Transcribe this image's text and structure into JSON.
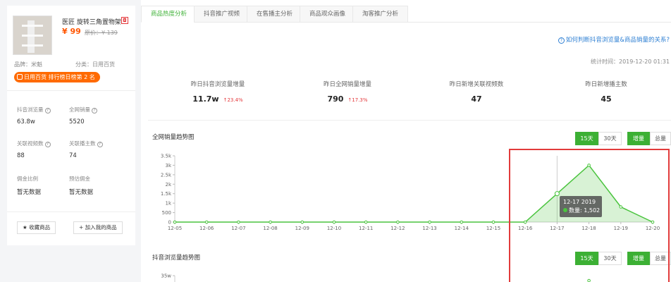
{
  "product": {
    "name": "医匠 旋转三角置物架",
    "price": "¥ 99",
    "original_price": "原价：¥ 139",
    "brand": "品牌：米魁",
    "category": "分类：日用百货",
    "rank_badge": "日用百货 排行榜日榜第 2 名"
  },
  "left_stats": [
    {
      "label": "抖音浏览量",
      "value": "63.8w"
    },
    {
      "label": "全网销量",
      "value": "5520"
    },
    {
      "label": "关联视频数",
      "value": "88"
    },
    {
      "label": "关联播主数",
      "value": "74"
    },
    {
      "label": "佣金比例",
      "value": "暂无数据"
    },
    {
      "label": "预估佣金",
      "value": "暂无数据"
    }
  ],
  "left_buttons": {
    "favorite": "收藏商品",
    "add": "加入我的商品"
  },
  "tabs": [
    "商品热度分析",
    "抖音推广视频",
    "在售播主分析",
    "商品观众画像",
    "淘客推广分析"
  ],
  "active_tab": 0,
  "help_link": "如何判断抖音浏览量&商品销量的关系?",
  "stat_time": "统计时间：2019-12-20 01:31",
  "kpis": [
    {
      "label": "昨日抖音浏览量增量",
      "value": "11.7w",
      "change": "↑23.4%"
    },
    {
      "label": "昨日全网销量增量",
      "value": "790",
      "change": "↑17.3%"
    },
    {
      "label": "昨日新增关联视频数",
      "value": "47",
      "change": ""
    },
    {
      "label": "昨日新增播主数",
      "value": "45",
      "change": ""
    }
  ],
  "chart1": {
    "title": "全网销量趋势图",
    "range_buttons": [
      "15天",
      "30天"
    ],
    "mode_buttons": [
      "增量",
      "总量"
    ],
    "tooltip": {
      "date": "12-17 2019",
      "label": "数量: 1,502"
    }
  },
  "chart2": {
    "title": "抖音浏览量趋势图",
    "range_buttons": [
      "15天",
      "30天"
    ],
    "mode_buttons": [
      "增量",
      "总量"
    ],
    "y_top_tick": "35w"
  },
  "colors": {
    "accent": "#3cb034",
    "highlight_box": "#e23b3b",
    "price": "#ff5500"
  },
  "chart_data": {
    "type": "area",
    "title": "全网销量趋势图",
    "x": [
      "12-05",
      "12-06",
      "12-07",
      "12-08",
      "12-09",
      "12-10",
      "12-11",
      "12-12",
      "12-13",
      "12-14",
      "12-15",
      "12-16",
      "12-17",
      "12-18",
      "12-19",
      "12-20"
    ],
    "y_ticks": [
      "0",
      "500",
      "1k",
      "1.5k",
      "2k",
      "2.5k",
      "3k",
      "3.5k"
    ],
    "values": [
      0,
      0,
      0,
      0,
      0,
      0,
      0,
      0,
      0,
      0,
      0,
      0,
      1502,
      3000,
      800,
      0
    ],
    "ylim": [
      0,
      3500
    ],
    "grid": false
  }
}
